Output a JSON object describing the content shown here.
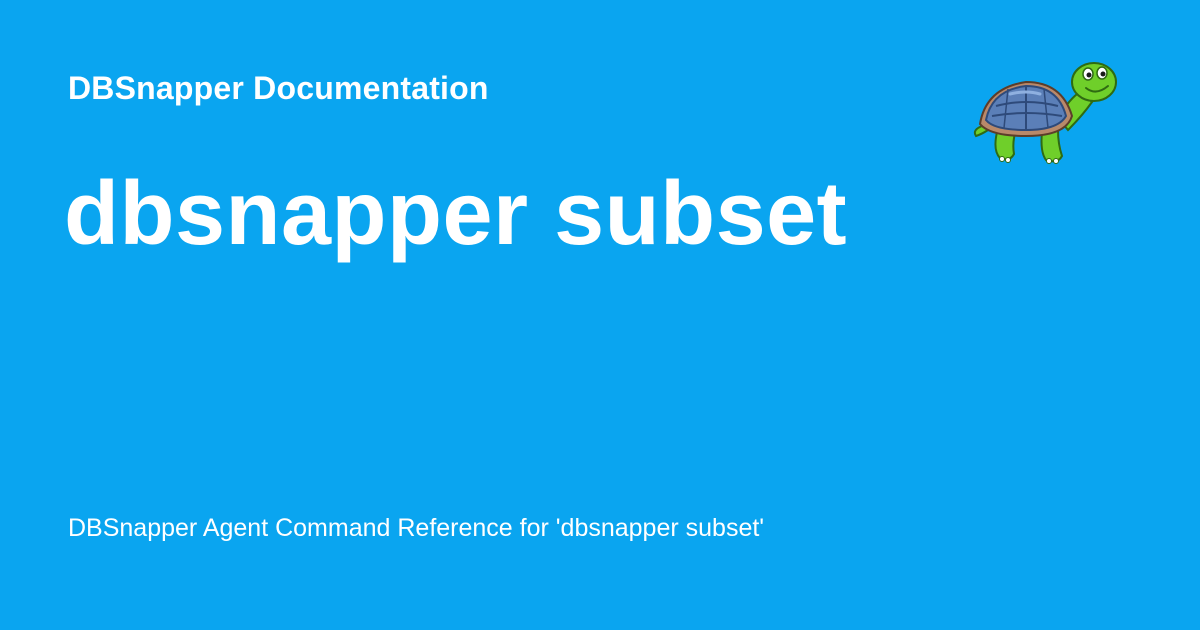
{
  "site_name": "DBSnapper Documentation",
  "page_title": "dbsnapper subset",
  "description": "DBSnapper Agent Command Reference for 'dbsnapper subset'",
  "logo_icon": "turtle-mascot-icon",
  "colors": {
    "background": "#0aa5f0",
    "text": "#ffffff",
    "turtle_skin": "#6fcf2a",
    "turtle_shell": "#5b7fb8",
    "shell_rim": "#b9896a"
  }
}
